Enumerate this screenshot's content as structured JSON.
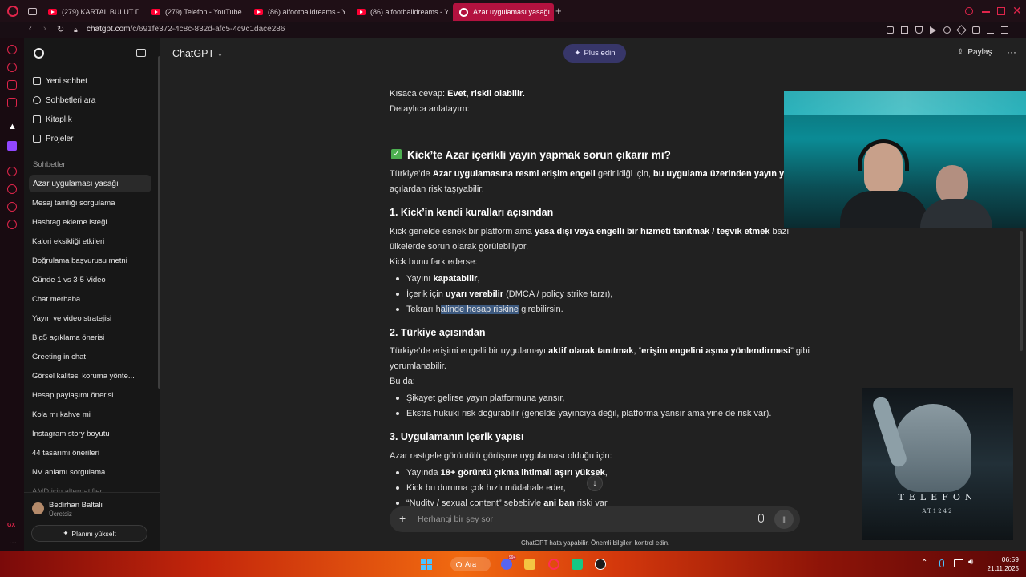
{
  "browser": {
    "tabs": [
      {
        "title": "(279) KARTAL BULUT DÖ",
        "icon": "youtube-icon",
        "active": false
      },
      {
        "title": "(279) Telefon - YouTube",
        "icon": "youtube-icon",
        "active": false
      },
      {
        "title": "(86) alfootballdreams - Yo",
        "icon": "youtube-icon",
        "active": false
      },
      {
        "title": "(86) alfootballdreams - Yo",
        "icon": "youtube-icon",
        "active": false
      },
      {
        "title": "Azar uygulaması yasağı",
        "icon": "chatgpt-icon",
        "active": true
      }
    ],
    "url_host": "chatgpt.com",
    "url_path": "/c/691fe372-4c8c-832d-afc5-4c9c1dace286",
    "accent_color": "#b3123f"
  },
  "sidebar": {
    "nav": [
      {
        "label": "Yeni sohbet",
        "icon": "edit-icon"
      },
      {
        "label": "Sohbetleri ara",
        "icon": "search-icon"
      },
      {
        "label": "Kitaplık",
        "icon": "library-icon"
      },
      {
        "label": "Projeler",
        "icon": "folder-icon"
      }
    ],
    "section_title": "Sohbetler",
    "chats": [
      "Azar uygulaması yasağı",
      "Mesaj tamlığı sorgulama",
      "Hashtag ekleme isteği",
      "Kalori eksikliği etkileri",
      "Doğrulama başvurusu metni",
      "Günde 1 vs 3-5 Video",
      "Chat merhaba",
      "Yayın ve video stratejisi",
      "Big5 açıklama önerisi",
      "Greeting in chat",
      "Görsel kalitesi koruma yönte...",
      "Hesap paylaşımı önerisi",
      "Kola mı kahve mi",
      "Instagram story boyutu",
      "44 tasarımı önerileri",
      "NV anlamı sorgulama",
      "AMD için alternatifler"
    ],
    "user": {
      "name": "Bedirhan Baltalı",
      "plan": "Ücretsiz",
      "initials": "B"
    },
    "upgrade_label": "Planını yükselt"
  },
  "header": {
    "model": "ChatGPT",
    "plus_label": "Plus edin",
    "share_label": "Paylaş"
  },
  "content": {
    "short_answer_prefix": "Kısaca cevap: ",
    "short_answer": "Evet, riskli olabilir.",
    "detail_intro": "Detaylıca anlatayım:",
    "heading_main": "Kick’te Azar içerikli yayın yapmak sorun çıkarır mı?",
    "intro_line1_a": "Türkiye’de ",
    "intro_line1_b": "Azar uygulamasına resmi erişim engeli",
    "intro_line1_c": " getirildiği için, ",
    "intro_line1_d": "bu uygulama üzerinden yayın yapmak",
    "intro_line2": "açılardan risk taşıyabilir:",
    "s1_title": "1. Kick’in kendi kuralları açısından",
    "s1_p1_a": "Kick genelde esnek bir platform ama ",
    "s1_p1_b": "yasa dışı veya engelli bir hizmeti tanıtmak / teşvik etmek",
    "s1_p1_c": " bazı",
    "s1_p2": "ülkelerde sorun olarak görülebiliyor.",
    "s1_p3": "Kick bunu fark ederse:",
    "s1_b1_a": "Yayını ",
    "s1_b1_b": "kapatabilir",
    "s1_b1_c": ",",
    "s1_b2_a": "İçerik için ",
    "s1_b2_b": "uyarı verebilir",
    "s1_b2_c": " (DMCA / policy strike tarzı),",
    "s1_b3_a": "Tekrarı h",
    "s1_b3_sel": "alinde hesap riskine",
    "s1_b3_c": " girebilirsin.",
    "s2_title": "2. Türkiye açısından",
    "s2_p1_a": "Türkiye’de erişimi engelli bir uygulamayı ",
    "s2_p1_b": "aktif olarak tanıtmak",
    "s2_p1_c": ", “",
    "s2_p1_d": "erişim engelini aşma yönlendirmesi",
    "s2_p1_e": "” gibi",
    "s2_p2": "yorumlanabilir.",
    "s2_p3": "Bu da:",
    "s2_b1": "Şikayet gelirse yayın platformuna yansır,",
    "s2_b2": "Ekstra hukuki risk doğurabilir (genelde yayıncıya değil, platforma yansır ama yine de risk var).",
    "s3_title": "3. Uygulamanın içerik yapısı",
    "s3_p1": "Azar rastgele görüntülü görüşme uygulaması olduğu için:",
    "s3_b1_a": "Yayında ",
    "s3_b1_b": "18+ görüntü çıkma ihtimali aşırı yüksek",
    "s3_b1_c": ",",
    "s3_b2": "Kick bu duruma çok hızlı müdahale eder,",
    "s3_b3_a": "“Nudity / sexual content” sebebiyle ",
    "s3_b3_b": "ani ban",
    "s3_b3_c": " riski var"
  },
  "composer": {
    "placeholder": "Herhangi bir şey sor",
    "disclaimer": "ChatGPT hata yapabilir. Önemli bilgileri kontrol edin."
  },
  "overlay": {
    "poster_title": "TELEFON",
    "poster_sub": "AT1242"
  },
  "taskbar": {
    "search_label": "Ara",
    "time": "06:59",
    "date": "21.11.2025",
    "notification_badge": "99+"
  }
}
